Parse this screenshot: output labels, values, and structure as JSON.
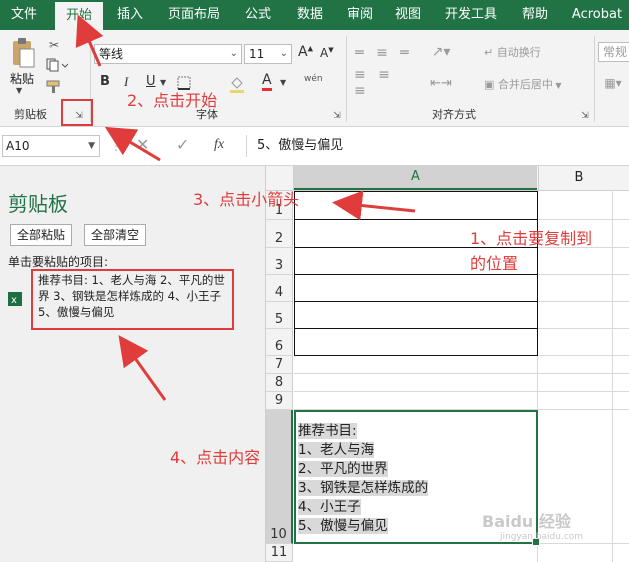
{
  "tabs": [
    "文件",
    "开始",
    "插入",
    "页面布局",
    "公式",
    "数据",
    "审阅",
    "视图",
    "开发工具",
    "帮助",
    "Acrobat"
  ],
  "clipboard_group": {
    "paste_label": "粘贴",
    "group_label": "剪贴板"
  },
  "font_group": {
    "font_name": "等线",
    "font_size": "11",
    "bold": "B",
    "italic": "I",
    "underline": "U",
    "grow_font": "A",
    "shrink_font": "A",
    "font_color_glyph": "A",
    "phonetic": "wén",
    "group_label": "字体"
  },
  "align_group": {
    "wrap_text": "自动换行",
    "merge_center": "合并后居中",
    "group_label": "对齐方式"
  },
  "number_group": {
    "format_value": "常规"
  },
  "formula_bar": {
    "cell_ref": "A10",
    "fx": "fx",
    "content": "5、傲慢与偏见"
  },
  "clipboard_pane": {
    "title": "剪贴板",
    "paste_all": "全部粘贴",
    "clear_all": "全部清空",
    "instruction": "单击要粘贴的项目:",
    "item_text": "推荐书目: 1、老人与海 2、平凡的世界 3、钢铁是怎样炼成的 4、小王子 5、傲慢与偏见"
  },
  "sheet": {
    "columns": [
      "A",
      "B"
    ],
    "rows": [
      "1",
      "2",
      "3",
      "4",
      "5",
      "6",
      "7",
      "8",
      "9",
      "10",
      "11"
    ],
    "a10_lines": [
      "推荐书目:",
      "1、老人与海",
      "2、平凡的世界",
      "3、钢铁是怎样炼成的",
      "4、小王子",
      "5、傲慢与偏见"
    ]
  },
  "annotations": {
    "step1_line1": "1、点击要复制到",
    "step1_line2": "的位置",
    "step2": "2、点击开始",
    "step3": "3、点击小箭头",
    "step4": "4、点击内容"
  },
  "watermark": {
    "brand": "Baidu 经验",
    "url": "jingyan.baidu.com"
  },
  "colors": {
    "excel_green": "#217346",
    "annotation_red": "#e03c3c"
  }
}
